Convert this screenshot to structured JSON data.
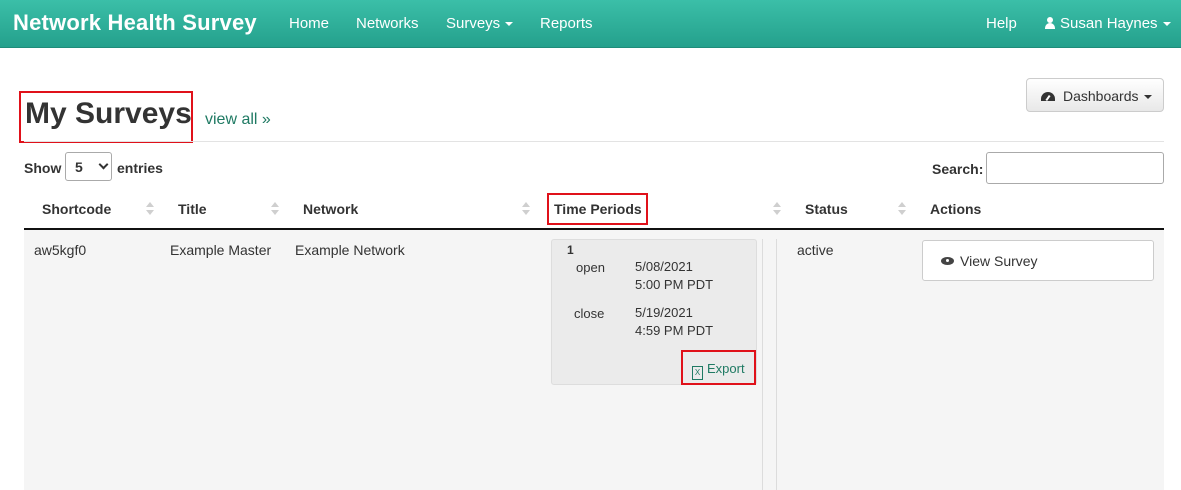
{
  "navbar": {
    "brand": "Network Health Survey",
    "items": [
      {
        "label": "Home"
      },
      {
        "label": "Networks"
      },
      {
        "label": "Surveys"
      },
      {
        "label": "Reports"
      }
    ],
    "help": "Help",
    "user": "Susan Haynes"
  },
  "header": {
    "title": "My Surveys",
    "view_all": "view all »",
    "dashboards": "Dashboards"
  },
  "controls": {
    "show": "Show",
    "entries_value": "5",
    "entries": "entries",
    "search_label": "Search:",
    "search_value": ""
  },
  "table": {
    "columns": [
      "Shortcode",
      "Title",
      "Network",
      "Time Periods",
      "Status",
      "Actions"
    ],
    "rows": [
      {
        "shortcode": "aw5kgf0",
        "title": "Example Master",
        "network": "Example Network",
        "time_periods": {
          "number": "1",
          "open_label": "open",
          "open_date": "5/08/2021",
          "open_time": "5:00 PM PDT",
          "close_label": "close",
          "close_date": "5/19/2021",
          "close_time": "4:59 PM PDT",
          "export": "Export"
        },
        "status": "active",
        "action": "View Survey"
      }
    ]
  },
  "colors": {
    "navbar": "#2bae98",
    "link": "#1f7a63",
    "highlight": "#e0111a"
  },
  "icons": {
    "user": "user-icon",
    "dashboards": "dashboard-icon",
    "export": "excel-file-icon",
    "view": "eye-icon"
  }
}
